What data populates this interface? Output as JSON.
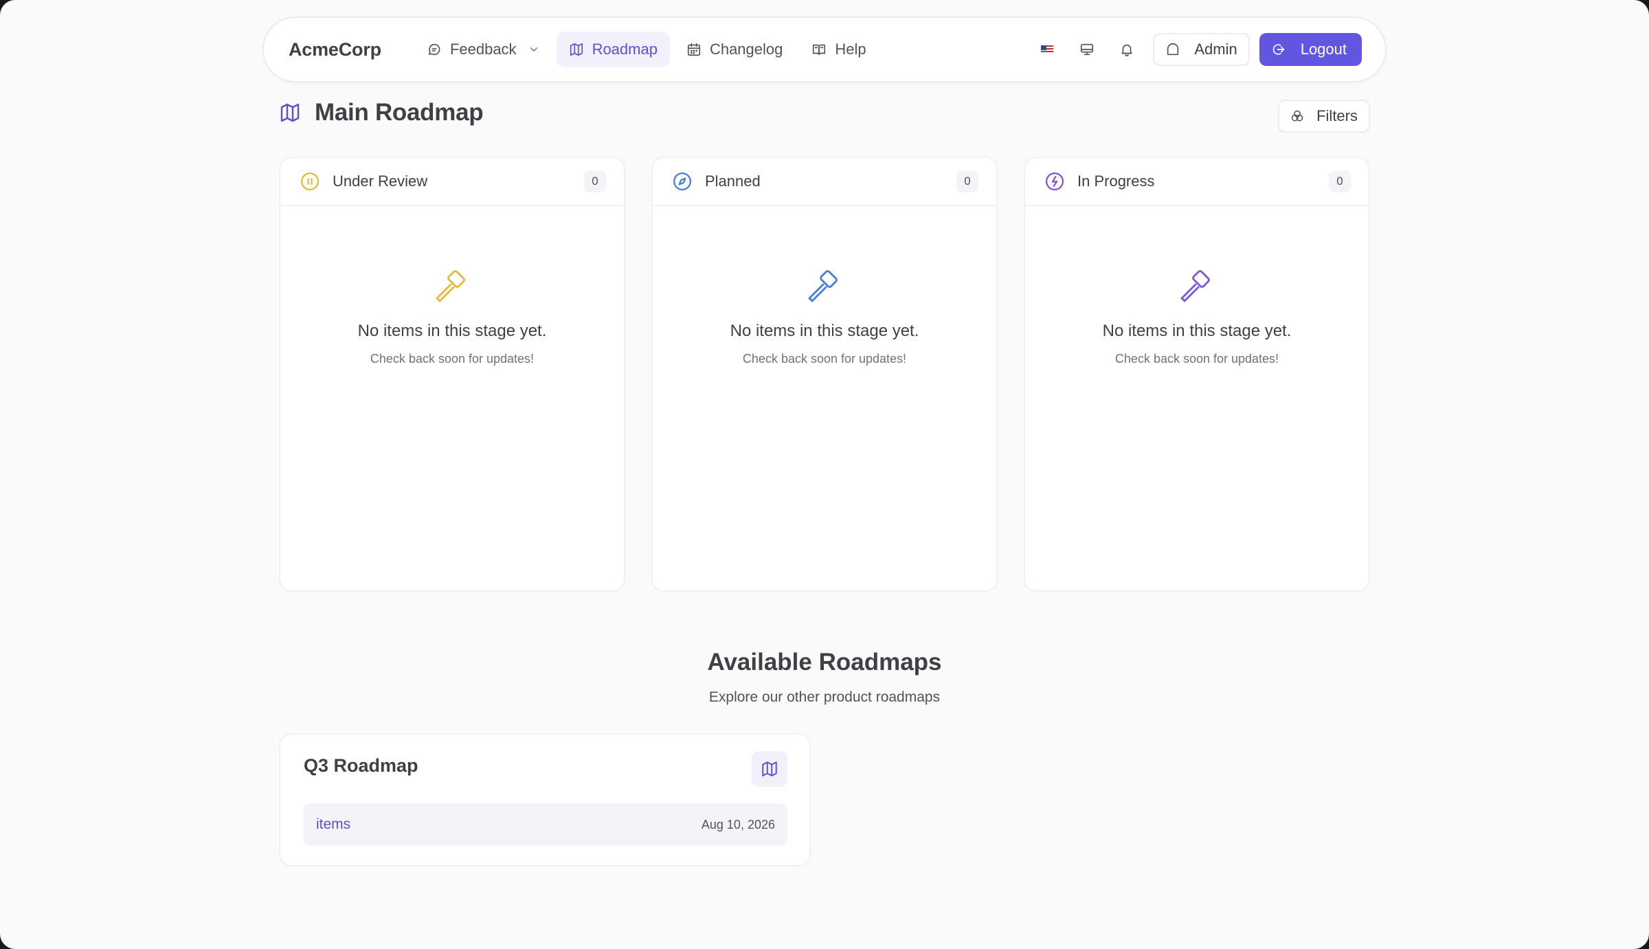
{
  "navbar": {
    "brand": "AcmeCorp",
    "items": [
      {
        "label": "Feedback",
        "icon": "message-icon",
        "has_dropdown": true,
        "active": false
      },
      {
        "label": "Roadmap",
        "icon": "map-icon",
        "active": true
      },
      {
        "label": "Changelog",
        "icon": "calendar-icon",
        "active": false
      },
      {
        "label": "Help",
        "icon": "book-icon",
        "active": false
      }
    ],
    "right": {
      "language_icon": "us-flag-icon",
      "display_icon": "monitor-icon",
      "notification_icon": "bell-icon",
      "admin_label": "Admin",
      "logout_label": "Logout"
    }
  },
  "page": {
    "title": "Main Roadmap",
    "filters_label": "Filters"
  },
  "columns": [
    {
      "title": "Under Review",
      "count": "0",
      "color": "#e5b93a",
      "empty_title": "No items in this stage yet.",
      "empty_sub": "Check back soon for updates!"
    },
    {
      "title": "Planned",
      "count": "0",
      "color": "#4a7be0",
      "empty_title": "No items in this stage yet.",
      "empty_sub": "Check back soon for updates!"
    },
    {
      "title": "In Progress",
      "count": "0",
      "color": "#7c55e0",
      "empty_title": "No items in this stage yet.",
      "empty_sub": "Check back soon for updates!"
    }
  ],
  "available": {
    "title": "Available Roadmaps",
    "subtitle": "Explore our other product roadmaps",
    "roadmaps": [
      {
        "title": "Q3 Roadmap",
        "items_label": "items",
        "date": "Aug 10, 2026"
      }
    ]
  },
  "colors": {
    "accent": "#6156e0",
    "accent_text": "#5b50d6",
    "accent_bg": "#f1f0fb"
  }
}
